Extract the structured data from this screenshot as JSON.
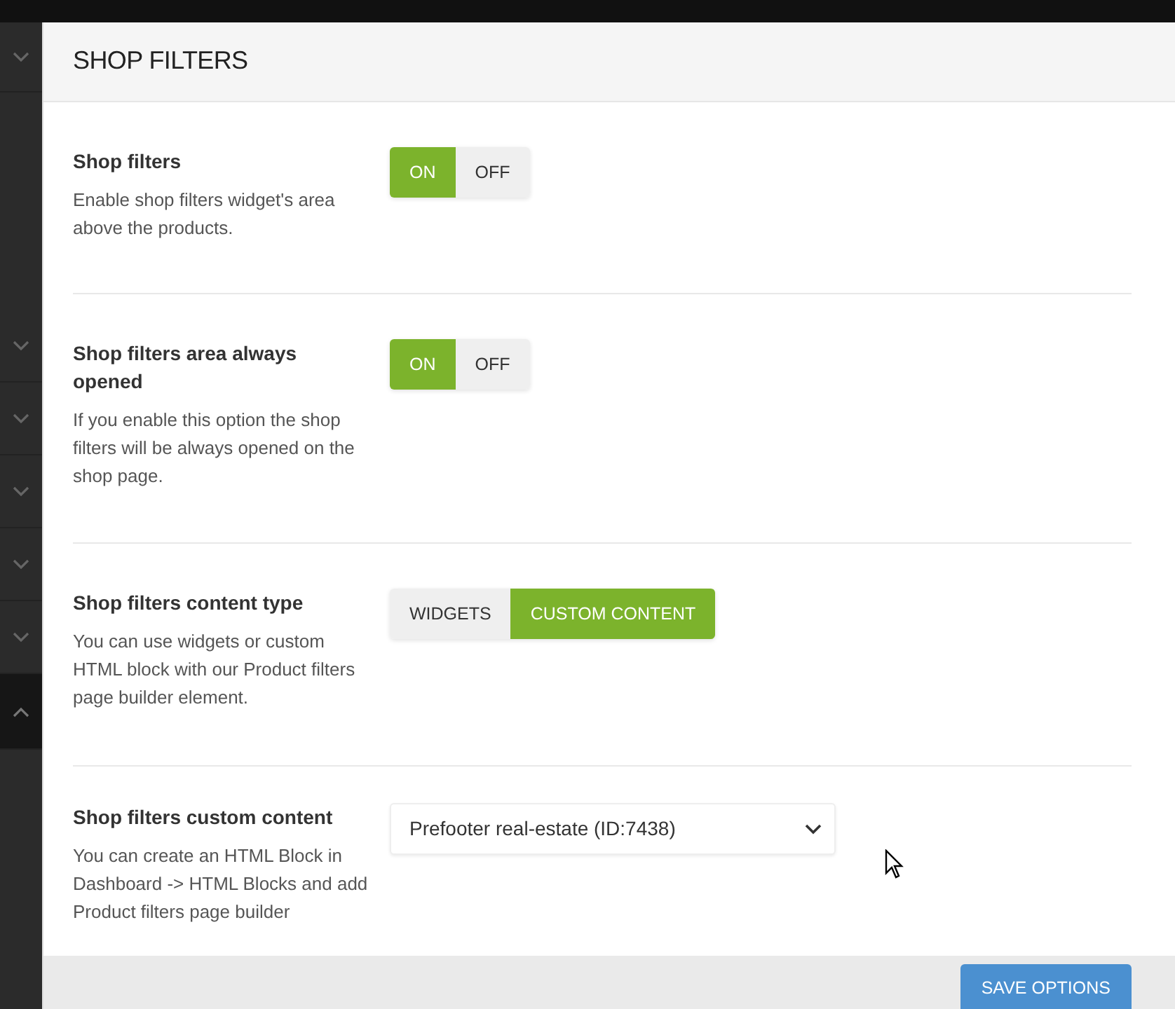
{
  "sidebar": {
    "items": [
      {
        "expanded": false
      },
      {
        "expanded": false
      },
      {
        "expanded": false
      },
      {
        "expanded": false
      },
      {
        "expanded": false
      },
      {
        "expanded": false
      },
      {
        "expanded": true
      }
    ]
  },
  "panel": {
    "title": "SHOP FILTERS",
    "settings": [
      {
        "kind": "toggle",
        "label": "Shop filters",
        "description": "Enable shop filters widget's area above the products.",
        "options": [
          {
            "label": "ON",
            "selected": true
          },
          {
            "label": "OFF",
            "selected": false
          }
        ]
      },
      {
        "kind": "toggle",
        "label": "Shop filters area always opened",
        "description": "If you enable this option the shop filters will be always opened on the shop page.",
        "options": [
          {
            "label": "ON",
            "selected": true
          },
          {
            "label": "OFF",
            "selected": false
          }
        ]
      },
      {
        "kind": "toggle",
        "label": "Shop filters content type",
        "description": "You can use widgets or custom HTML block with our Product filters page builder element.",
        "options": [
          {
            "label": "WIDGETS",
            "selected": false
          },
          {
            "label": "CUSTOM CONTENT",
            "selected": true
          }
        ]
      },
      {
        "kind": "select",
        "label": "Shop filters custom content",
        "description": "You can create an HTML Block in Dashboard -> HTML Blocks and add Product filters page builder",
        "value": "Prefooter real-estate (ID:7438)"
      }
    ],
    "save_button": "SAVE OPTIONS"
  }
}
